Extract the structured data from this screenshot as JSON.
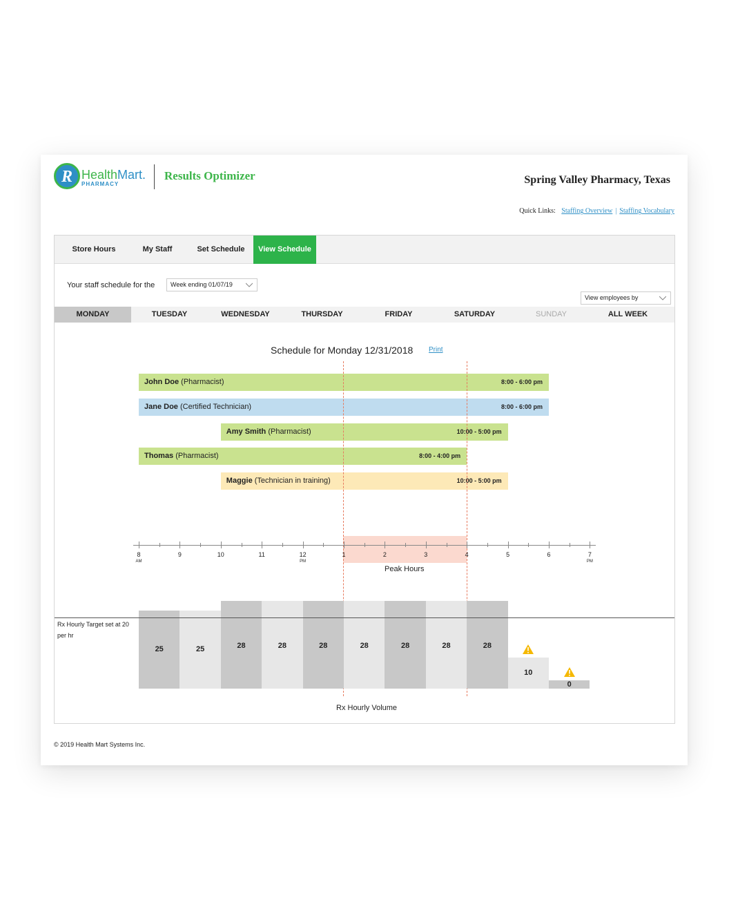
{
  "header": {
    "logo_name": "Health",
    "logo_name_2": "Mart.",
    "logo_sub": "PHARMACY",
    "logo_letter": "R",
    "product": "Results Optimizer",
    "store": "Spring Valley Pharmacy, Texas",
    "quick_links_label": "Quick Links:",
    "quick_links": [
      "Staffing Overview",
      "Staffing Vocabulary"
    ]
  },
  "tabs": [
    {
      "label": "Store Hours",
      "active": false
    },
    {
      "label": "My Staff",
      "active": false
    },
    {
      "label": "Set Schedule",
      "active": false
    },
    {
      "label": "View Schedule",
      "active": true
    }
  ],
  "schedule_for_label": "Your staff schedule for the",
  "week_select": "Week ending 01/07/19",
  "view_by_select": "View employees by",
  "days": [
    {
      "label": "MONDAY",
      "state": "active"
    },
    {
      "label": "TUESDAY",
      "state": "normal"
    },
    {
      "label": "WEDNESDAY",
      "state": "normal"
    },
    {
      "label": "THURSDAY",
      "state": "normal"
    },
    {
      "label": "FRIDAY",
      "state": "normal"
    },
    {
      "label": "SATURDAY",
      "state": "normal"
    },
    {
      "label": "SUNDAY",
      "state": "muted"
    },
    {
      "label": "ALL WEEK",
      "state": "normal"
    }
  ],
  "schedule_title": "Schedule for Monday 12/31/2018",
  "print_label": "Print",
  "shifts": [
    {
      "name": "John Doe",
      "role": "(Pharmacist)",
      "time": "8:00 - 6:00 pm",
      "start": 8,
      "end": 18,
      "color": "#c9e28f"
    },
    {
      "name": "Jane Doe",
      "role": "(Certified Technician)",
      "time": "8:00 - 6:00 pm",
      "start": 8,
      "end": 18,
      "color": "#bfdcef"
    },
    {
      "name": "Amy Smith",
      "role": "(Pharmacist)",
      "time": "10:00 - 5:00 pm",
      "start": 10,
      "end": 17,
      "color": "#c9e28f"
    },
    {
      "name": "Thomas",
      "role": "(Pharmacist)",
      "time": "8:00 - 4:00 pm",
      "start": 8,
      "end": 16,
      "color": "#c9e28f"
    },
    {
      "name": "Maggie",
      "role": "(Technician in training)",
      "time": "10:00 - 5:00 pm",
      "start": 10,
      "end": 17,
      "color": "#fde9b7"
    }
  ],
  "axis": {
    "ticks": [
      {
        "label": "8",
        "sub": "AM"
      },
      {
        "label": "9",
        "sub": ""
      },
      {
        "label": "10",
        "sub": ""
      },
      {
        "label": "11",
        "sub": ""
      },
      {
        "label": "12",
        "sub": "PM"
      },
      {
        "label": "1",
        "sub": ""
      },
      {
        "label": "2",
        "sub": ""
      },
      {
        "label": "3",
        "sub": ""
      },
      {
        "label": "4",
        "sub": ""
      },
      {
        "label": "5",
        "sub": ""
      },
      {
        "label": "6",
        "sub": ""
      },
      {
        "label": "7",
        "sub": "PM"
      }
    ],
    "peak_label": "Peak Hours",
    "peak_start": 13,
    "peak_end": 16
  },
  "target_label": "Rx Hourly Target set at 20 per hr",
  "volume_label": "Rx Hourly Volume",
  "chart_data": {
    "type": "bar",
    "categories": [
      "8",
      "9",
      "10",
      "11",
      "12",
      "1",
      "2",
      "3",
      "4",
      "5",
      "6"
    ],
    "values": [
      25,
      25,
      28,
      28,
      28,
      28,
      28,
      28,
      28,
      10,
      0
    ],
    "target": 20,
    "warnings": [
      false,
      false,
      false,
      false,
      false,
      false,
      false,
      false,
      false,
      true,
      true
    ],
    "xlabel": "Rx Hourly Volume",
    "ylim": [
      0,
      28
    ]
  },
  "footer": "© 2019 Health Mart Systems Inc."
}
